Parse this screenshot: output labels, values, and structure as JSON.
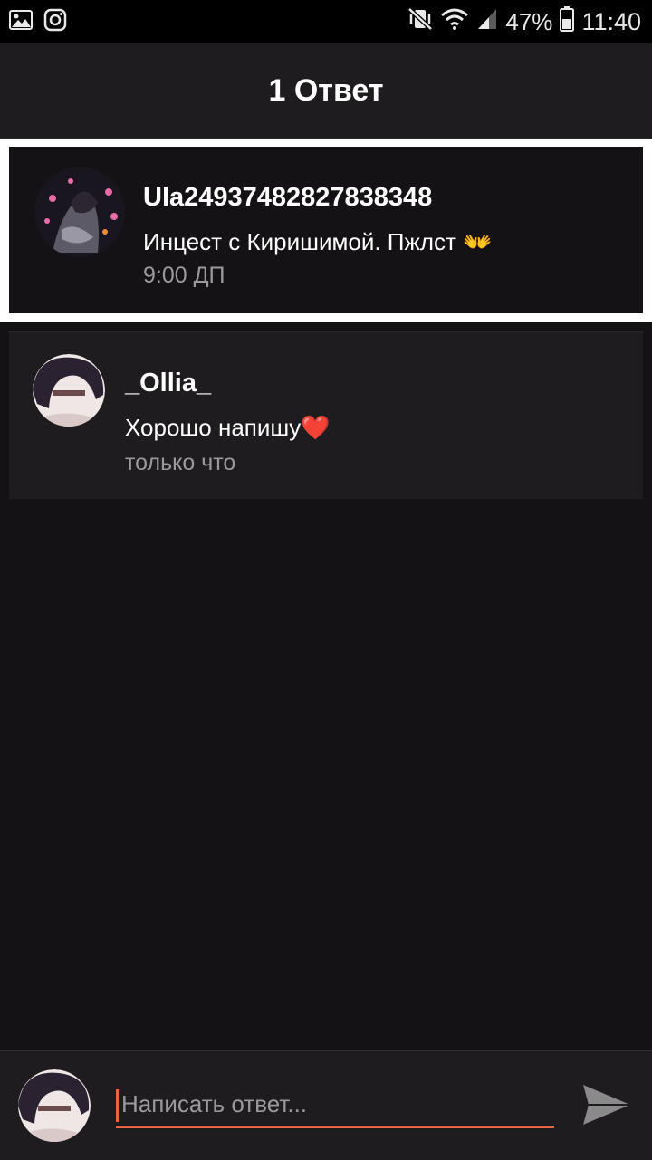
{
  "status_bar": {
    "battery": "47%",
    "time": "11:40",
    "icons": [
      "gallery-icon",
      "instagram-icon",
      "vibrate-mute-icon",
      "wifi-icon",
      "signal-icon",
      "battery-icon"
    ]
  },
  "header": {
    "title": "1 Ответ"
  },
  "parent_comment": {
    "author": "Ula24937482827838348",
    "text": "Инцест с Киришимой. Пжлст 👐",
    "time": "9:00 ДП"
  },
  "reply": {
    "author": "_Ollia_",
    "text": "Хорошо напишу❤️",
    "time": "только что"
  },
  "composer": {
    "placeholder": "Написать ответ..."
  },
  "colors": {
    "accent": "#e9673e",
    "background": "#141214",
    "card": "#1e1c1e",
    "muted_text": "#9b9a9b"
  }
}
